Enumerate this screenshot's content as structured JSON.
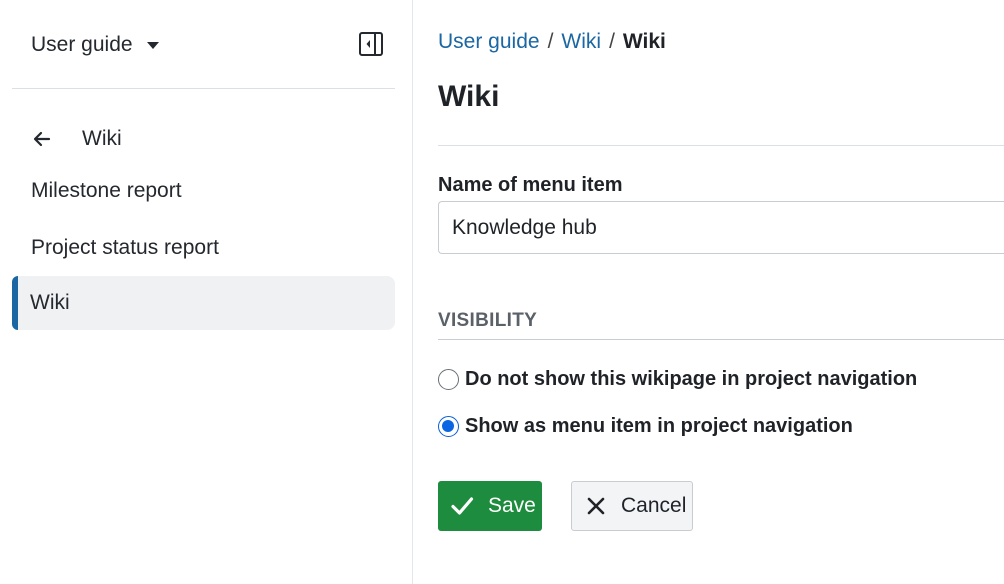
{
  "sidebar": {
    "project_name": "User guide",
    "back_label": "Wiki",
    "items": [
      {
        "label": "Milestone report"
      },
      {
        "label": "Project status report"
      },
      {
        "label": "Wiki",
        "active": true
      }
    ]
  },
  "breadcrumb": {
    "items": [
      "User guide",
      "Wiki"
    ],
    "separator": "/",
    "current": "Wiki"
  },
  "page": {
    "title": "Wiki"
  },
  "form": {
    "name_label": "Name of menu item",
    "name_value": "Knowledge hub",
    "visibility_title": "VISIBILITY",
    "options": [
      {
        "label": "Do not show this wikipage in project navigation",
        "checked": false
      },
      {
        "label": "Show as menu item in project navigation",
        "checked": true
      }
    ],
    "save_label": "Save",
    "cancel_label": "Cancel"
  },
  "colors": {
    "accent": "#1a67a3",
    "save_button": "#1e8c3e",
    "radio_checked": "#0b66e4"
  },
  "icons": {
    "project_dropdown": "chevron-down-icon",
    "collapse": "sidebar-collapse-icon",
    "back": "arrow-left-icon",
    "save": "check-icon",
    "cancel": "close-icon"
  }
}
